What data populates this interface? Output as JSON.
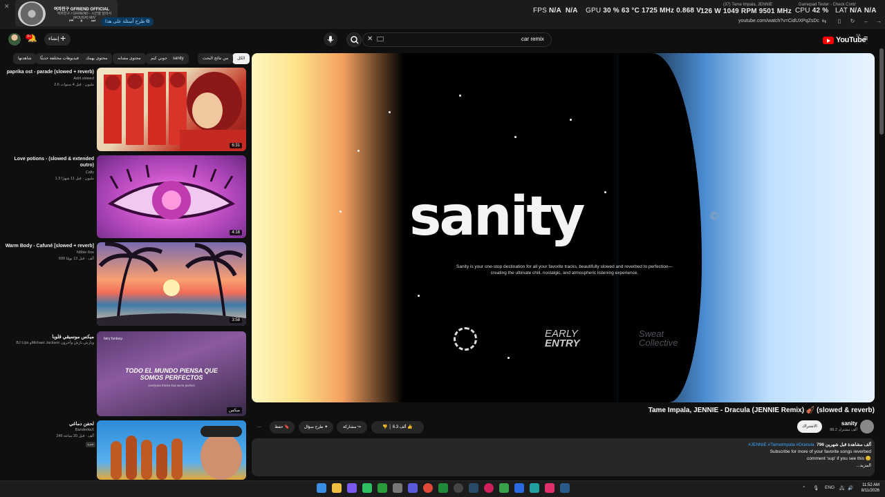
{
  "os_overlay": {
    "close_icon": "close-icon",
    "now_playing": {
      "title": "여자친구 GFRIEND OFFICIAL",
      "subtitle": "여자친구 / GFRIEND - 시간을 달려서 (ROUGH) M/V"
    },
    "ask_label": "طرح أسئلة على هذا",
    "hud": {
      "fps_label": "FPS",
      "fps_value": "N/A",
      "fps_value2": "N/A",
      "gpu_label": "GPU",
      "gpu_util": "30 %",
      "gpu_temp": "63 °C",
      "gpu_clock": "1725 MHz",
      "gpu_volt": "0.868 V",
      "gpu_power": "126 W",
      "gpu_fan": "1049 RPM",
      "gpu_mem": "9501 MHz",
      "cpu_label": "CPU",
      "cpu_util": "42 %",
      "lat_label": "LAT",
      "lat_value": "N/A",
      "lat_value2": "N/A"
    },
    "tabs": [
      "(37) Tame Impala, JENNIE",
      "Gamepad Tester - Check Contr"
    ],
    "url": "youtube.com/watch?v=CidUXPqZsDc"
  },
  "header": {
    "logo_text": "YouTube",
    "logo_country": "SA",
    "search_value": "car remix",
    "create_label": "إنشاء",
    "notif_count": "9+"
  },
  "chips": [
    "الكل",
    "من نتائج البحث",
    "sanity",
    "جوني كيم",
    "محتوى مشابه",
    "محتوى يهمك",
    "فيديوهات مختلفة حديثًا",
    "شاهدتها"
  ],
  "sidebar_videos": [
    {
      "title": "paprika ost - parade (slowed + reverb)",
      "channel": "Adrii.slowed",
      "meta": "2.6 مليون · قبل 4 سنوات",
      "duration": "6:31"
    },
    {
      "title": "Love potions - (slowed & extended outro)",
      "channel": "Cally",
      "meta": "1.3 مليون · قبل 11 شهرًا",
      "duration": "4:18"
    },
    {
      "title": "Warm Body - Cafuné [slowed + reverb]",
      "channel": "N8ble 6ne",
      "meta": "690 ألف · قبل 13 يومًا",
      "duration": "3:58"
    },
    {
      "title": "ميكس موسيقي قلوبا",
      "channel": "BJ Lips وMichael Jackson وبارش بارش وآخرون",
      "meta": "",
      "duration": "ميكس",
      "overlay_text": "TODO EL MUNDO PIENSA QUE SOMOS PERFECTOS",
      "overlay_sub": "everyone thinks that we're perfect",
      "overlay_tag": "fairy fantasy."
    },
    {
      "title": "لحفن دماغي",
      "channel": "BanderitaX",
      "meta": "246 ألف · قبل 20 ساعة",
      "badge": "جديد",
      "duration": ""
    }
  ],
  "player": {
    "brand_word": "sanity",
    "brand_mark": "©",
    "description": "Sanity is your one-stop destination for all your favorite tracks, beautifully slowed and reverbed to perfection—creating the ultimate chill, nostalgic, and atmospheric listening experience.",
    "early_top": "EARLY",
    "early_bottom": "ENTRY",
    "sweat_top": "Sweat",
    "sweat_bottom": "Collective"
  },
  "video": {
    "title": "Tame Impala, JENNIE - Dracula (JENNIE Remix) 🎻 (slowed & reverb)",
    "channel_name": "sanity",
    "channel_subs": "88.2 ألف مشترك",
    "subscribe_label": "الاشتراك",
    "likes": "6.3 ألف",
    "share_label": "مشاركة",
    "ask_label": "طرح سؤال",
    "save_label": "حفظ",
    "more_label": "···"
  },
  "description_box": {
    "stats": "796 ألف مشاهدة  قبل شهرين",
    "tags": "#JENNIE #TameImpala #Dracula",
    "line1": "Subscribe for more of your favorite songs reverbed",
    "line2": "comment 'sup' if you see this 😊",
    "more": "...المزيد"
  },
  "taskbar": {
    "lang": "ENG",
    "time": "11:52 AM",
    "date": "8/11/2026"
  }
}
